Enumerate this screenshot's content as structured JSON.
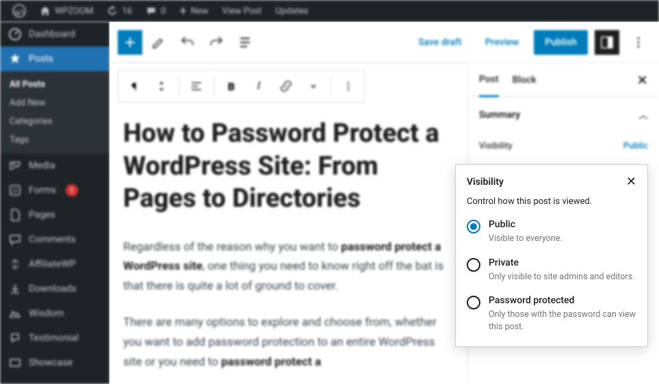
{
  "adminbar": {
    "site_name": "WPZOOM",
    "revisions": "16",
    "comments": "0",
    "new": "New",
    "view_post": "View Post",
    "updates": "Updates"
  },
  "sidebar": {
    "dashboard": "Dashboard",
    "posts": "Posts",
    "posts_sub": {
      "all": "All Posts",
      "add": "Add New",
      "categories": "Categories",
      "tags": "Tags"
    },
    "media": "Media",
    "forms": "Forms",
    "forms_badge": "1",
    "pages": "Pages",
    "comments": "Comments",
    "affiliatewp": "AffiliateWP",
    "downloads": "Downloads",
    "wisdom": "Wisdom",
    "testimonial": "Testimonial",
    "showcase": "Showcase"
  },
  "header": {
    "save_draft": "Save draft",
    "preview": "Preview",
    "publish": "Publish"
  },
  "content": {
    "title": "How to Password Protect a WordPress Site: From Pages to Directories",
    "p1a": "Regardless of the reason why you want to ",
    "p1b": "password protect a WordPress site",
    "p1c": ", one thing you need to know right off the bat is that there is quite a lot of ground to cover.",
    "p2a": "There are many options to explore and choose from, whether you want to add password protection to an entire WordPress site or you need to ",
    "p2b": "password protect a"
  },
  "panel": {
    "tab_post": "Post",
    "tab_block": "Block",
    "summary": "Summary",
    "visibility_label": "Visibility",
    "visibility_value": "Public"
  },
  "vis": {
    "title": "Visibility",
    "desc": "Control how this post is viewed.",
    "public": {
      "label": "Public",
      "desc": "Visible to everyone."
    },
    "private": {
      "label": "Private",
      "desc": "Only visible to site admins and editors."
    },
    "password": {
      "label": "Password protected",
      "desc": "Only those with the password can view this post."
    }
  }
}
